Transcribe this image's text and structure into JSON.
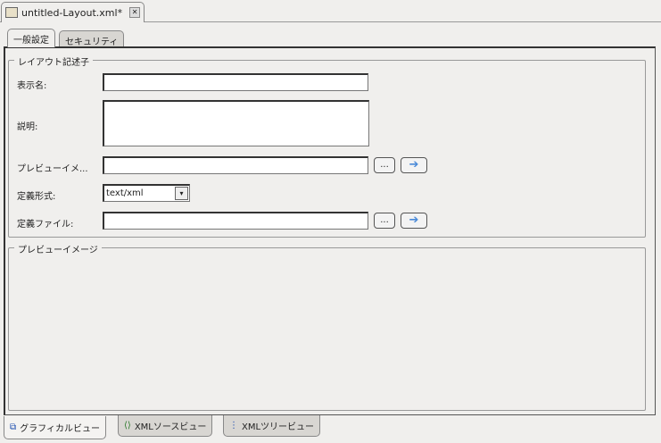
{
  "editor_tab": {
    "title": "untitled-Layout.xml*",
    "close": "✕"
  },
  "tabs": [
    {
      "label": "一般設定",
      "active": true
    },
    {
      "label": "セキュリティ",
      "active": false
    }
  ],
  "descriptor": {
    "legend": "レイアウト記述子",
    "display_name": {
      "label": "表示名:",
      "value": ""
    },
    "description": {
      "label": "説明:",
      "value": ""
    },
    "preview_image": {
      "label": "プレビューイメ...",
      "value": "",
      "browse": "..."
    },
    "format": {
      "label": "定義形式:",
      "value": "text/xml"
    },
    "def_file": {
      "label": "定義ファイル:",
      "value": "",
      "browse": "..."
    }
  },
  "preview": {
    "legend": "プレビューイメージ"
  },
  "bottom_tabs": [
    {
      "label": "グラフィカルビュー",
      "active": true
    },
    {
      "label": "XMLソースビュー"
    },
    {
      "label": "XMLツリービュー"
    }
  ],
  "colors": {
    "arrow": "#4a8ad8"
  }
}
